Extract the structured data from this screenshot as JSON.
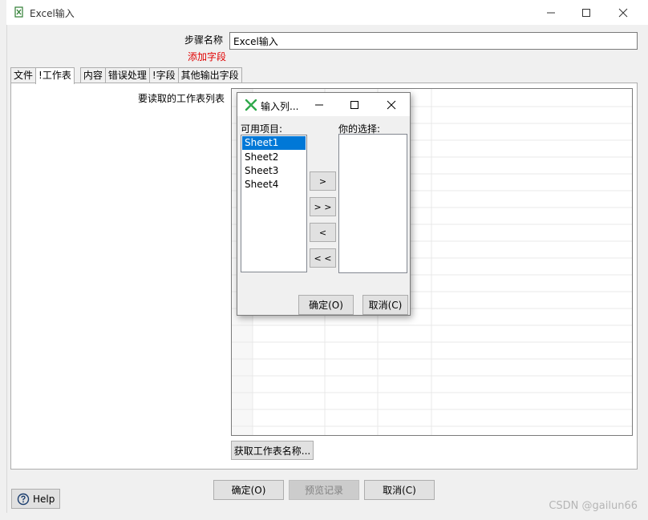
{
  "window": {
    "title": "Excel输入"
  },
  "form": {
    "step_name_label": "步骤名称",
    "step_name_value": "Excel输入",
    "add_field_link": "添加字段"
  },
  "tabs": [
    "文件",
    "!工作表",
    "内容",
    "错误处理",
    "!字段",
    "其他输出字段"
  ],
  "sheet_tab": {
    "list_label": "要读取的工作表列表",
    "get_sheets_button": "获取工作表名称..."
  },
  "dialog": {
    "title": "输入列...",
    "available_label": "可用项目:",
    "available_items": [
      "Sheet1",
      "Sheet2",
      "Sheet3",
      "Sheet4"
    ],
    "selected_index": 0,
    "selection_label": "你的选择:",
    "move_buttons": [
      ">",
      "> >",
      "<",
      "< <"
    ],
    "ok_button": "确定(O)",
    "cancel_button": "取消(C)"
  },
  "footer": {
    "help_button": "Help",
    "ok_button": "确定(O)",
    "preview_button": "预览记录",
    "cancel_button": "取消(C)"
  },
  "watermark": "CSDN @gailun66",
  "colors": {
    "selection": "#0078d7",
    "add_field": "#e00000"
  }
}
